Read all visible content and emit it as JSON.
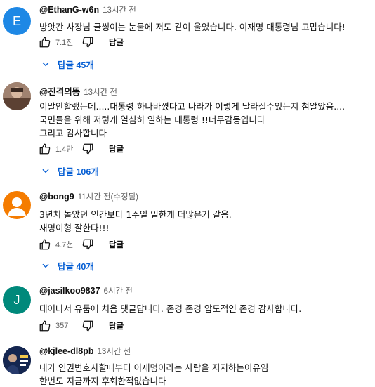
{
  "comments": [
    {
      "avatar_letter": "E",
      "avatar_color": "#1e88e5",
      "author": "@EthanG-w6n",
      "time": "13시간 전",
      "lines": [
        "방앗간 사장님 글썽이는 눈물에 저도 같이 울었습니다. 이재명 대통령님 고맙습니다!"
      ],
      "likes": "7.1천",
      "reply_label": "답글",
      "replies_label": "답글 45개"
    },
    {
      "avatar_letter": "",
      "avatar_color": "#8a6a55",
      "avatar_kind": "photo",
      "author": "@진격의똥",
      "time": "13시간 전",
      "lines": [
        "이말안할랬는데.....대통령 하나바꼈다고 나라가 이렇게 달라질수있는지 첨알았음....",
        "국민들을 위해 저렇게 열심히 일하는 대통령 !!너무감동입니다",
        "그리고 감사합니다"
      ],
      "likes": "1.4만",
      "reply_label": "답글",
      "replies_label": "답글 106개"
    },
    {
      "avatar_letter": "",
      "avatar_color": "#f57c00",
      "avatar_kind": "person",
      "author": "@bong9",
      "time": "11시간 전(수정됨)",
      "lines": [
        "3년치 놀았던 인간보다 1주일 일한게 더많은거 같음.",
        "재명이형 잘한다!!!"
      ],
      "likes": "4.7천",
      "reply_label": "답글",
      "replies_label": "답글 40개"
    },
    {
      "avatar_letter": "J",
      "avatar_color": "#00897b",
      "author": "@jasilkoo9837",
      "time": "6시간 전",
      "lines": [
        "태어나서 유툽에 처음 댓글답니다. 존경 존경 압도적인 존경 감사합니다."
      ],
      "likes": "357",
      "reply_label": "답글"
    },
    {
      "avatar_letter": "",
      "avatar_color": "#0d1b3d",
      "avatar_kind": "photo-dark",
      "author": "@kjlee-dl8pb",
      "time": "13시간 전",
      "lines": [
        "내가 인권변호사할때부터 이재명이라는 사람을 지지하는이유임",
        "한번도 지금까지 후회한적없습니다"
      ]
    }
  ]
}
